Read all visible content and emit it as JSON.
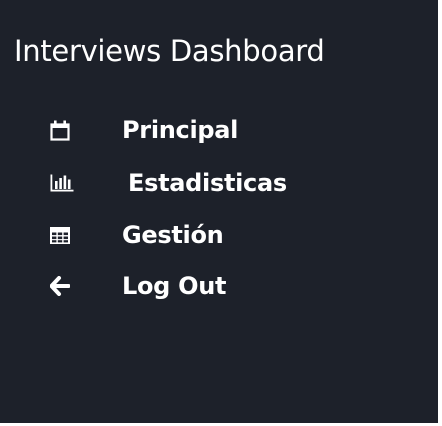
{
  "app": {
    "title": "Interviews Dashboard"
  },
  "nav": {
    "items": [
      {
        "label": "Principal",
        "icon": "calendar-icon"
      },
      {
        "label": "Estadisticas",
        "icon": "bar-chart-icon"
      },
      {
        "label": "Gestión",
        "icon": "table-icon"
      },
      {
        "label": "Log Out",
        "icon": "arrow-left-icon"
      }
    ]
  },
  "colors": {
    "sidebar_background": "#1d212a",
    "text": "#ffffff"
  }
}
